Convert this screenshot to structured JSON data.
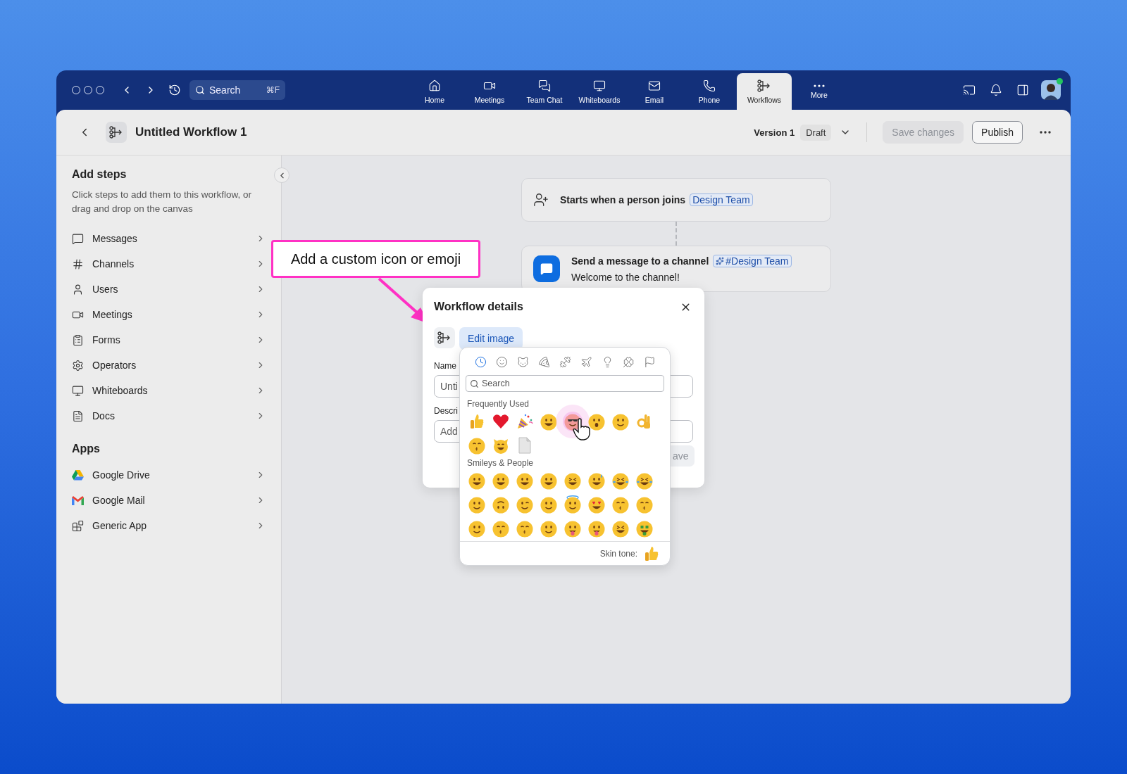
{
  "top_bar": {
    "search": {
      "placeholder": "Search",
      "shortcut": "⌘F"
    },
    "nav": [
      {
        "label": "Home",
        "kind": "home",
        "selected": false
      },
      {
        "label": "Meetings",
        "kind": "meetings",
        "selected": false
      },
      {
        "label": "Team Chat",
        "kind": "chat",
        "selected": false
      },
      {
        "label": "Whiteboards",
        "kind": "whiteboards",
        "selected": false
      },
      {
        "label": "Email",
        "kind": "email",
        "selected": false
      },
      {
        "label": "Phone",
        "kind": "phone",
        "selected": false
      },
      {
        "label": "Workflows",
        "kind": "workflows",
        "selected": true
      },
      {
        "label": "More",
        "kind": "more",
        "selected": false
      }
    ],
    "avatar": {
      "online": true
    }
  },
  "header": {
    "title": "Untitled Workflow 1",
    "version": "Version 1",
    "status": "Draft",
    "buttons": [
      {
        "label": "Save changes",
        "disabled": true
      },
      {
        "label": "Publish",
        "disabled": false
      }
    ]
  },
  "sidebar": {
    "title": "Add steps",
    "description": "Click steps to add them to this workflow, or drag and drop on the canvas",
    "steps": [
      {
        "label": "Messages",
        "kind": "messages"
      },
      {
        "label": "Channels",
        "kind": "channels"
      },
      {
        "label": "Users",
        "kind": "users"
      },
      {
        "label": "Meetings",
        "kind": "meetings"
      },
      {
        "label": "Forms",
        "kind": "forms"
      },
      {
        "label": "Operators",
        "kind": "operators"
      },
      {
        "label": "Whiteboards",
        "kind": "whiteboards"
      },
      {
        "label": "Docs",
        "kind": "docs"
      }
    ],
    "apps_title": "Apps",
    "apps": [
      {
        "label": "Google Drive",
        "kind": "drive"
      },
      {
        "label": "Google Mail",
        "kind": "mail"
      },
      {
        "label": "Generic App",
        "kind": "generic"
      }
    ]
  },
  "canvas": {
    "nodes": [
      {
        "kind": "trigger",
        "text": "Starts when a person joins",
        "tag": "Design Team"
      },
      {
        "kind": "message",
        "text": "Send a message to a channel",
        "tag": "#Design Team",
        "subtext": "Welcome to the channel!"
      }
    ]
  },
  "callout": {
    "text": "Add a custom icon or emoji"
  },
  "dialog": {
    "title": "Workflow details",
    "edit_button": "Edit image",
    "name_label": "Name",
    "name_value": "Unti",
    "description_label": "Descri",
    "description_placeholder": "Add",
    "save_button": {
      "label": "ave",
      "disabled": true
    }
  },
  "emoji_picker": {
    "categories": [
      {
        "kind": "recent",
        "selected": true
      },
      {
        "kind": "smileys",
        "selected": false
      },
      {
        "kind": "animals",
        "selected": false
      },
      {
        "kind": "food",
        "selected": false
      },
      {
        "kind": "activity",
        "selected": false
      },
      {
        "kind": "travel",
        "selected": false
      },
      {
        "kind": "objects",
        "selected": false
      },
      {
        "kind": "symbols",
        "selected": false
      },
      {
        "kind": "flags",
        "selected": false
      }
    ],
    "search_placeholder": "Search",
    "sections": [
      {
        "title": "Frequently Used",
        "items": [
          {
            "kind": "thumb",
            "selected": false
          },
          {
            "kind": "heart",
            "selected": false
          },
          {
            "kind": "party",
            "selected": false
          },
          {
            "kind": "grin",
            "selected": false
          },
          {
            "kind": "cool",
            "selected": true
          },
          {
            "kind": "surprised",
            "selected": false
          },
          {
            "kind": "smile",
            "selected": false
          },
          {
            "kind": "ok",
            "selected": false
          },
          {
            "kind": "kiss",
            "selected": false
          },
          {
            "kind": "cat",
            "selected": false
          },
          {
            "kind": "page",
            "selected": false
          }
        ]
      },
      {
        "title": "Smileys & People",
        "items": [
          {
            "kind": "grin",
            "selected": false
          },
          {
            "kind": "grin",
            "selected": false
          },
          {
            "kind": "grin",
            "selected": false
          },
          {
            "kind": "grin",
            "selected": false
          },
          {
            "kind": "squint",
            "selected": false
          },
          {
            "kind": "sweat",
            "selected": false
          },
          {
            "kind": "tears",
            "selected": false
          },
          {
            "kind": "tears",
            "selected": false
          },
          {
            "kind": "smile",
            "selected": false
          },
          {
            "kind": "upside",
            "selected": false
          },
          {
            "kind": "wink",
            "selected": false
          },
          {
            "kind": "smile",
            "selected": false
          },
          {
            "kind": "halo",
            "selected": false
          },
          {
            "kind": "heart-eyes",
            "selected": false
          },
          {
            "kind": "kiss",
            "selected": false
          },
          {
            "kind": "kiss",
            "selected": false
          },
          {
            "kind": "smile",
            "selected": false
          },
          {
            "kind": "kiss",
            "selected": false
          },
          {
            "kind": "kiss",
            "selected": false
          },
          {
            "kind": "smile",
            "selected": false
          },
          {
            "kind": "tongue",
            "selected": false
          },
          {
            "kind": "tongue",
            "selected": false
          },
          {
            "kind": "squint",
            "selected": false
          },
          {
            "kind": "money",
            "selected": false
          }
        ]
      }
    ],
    "skin_tone_label": "Skin tone:"
  }
}
